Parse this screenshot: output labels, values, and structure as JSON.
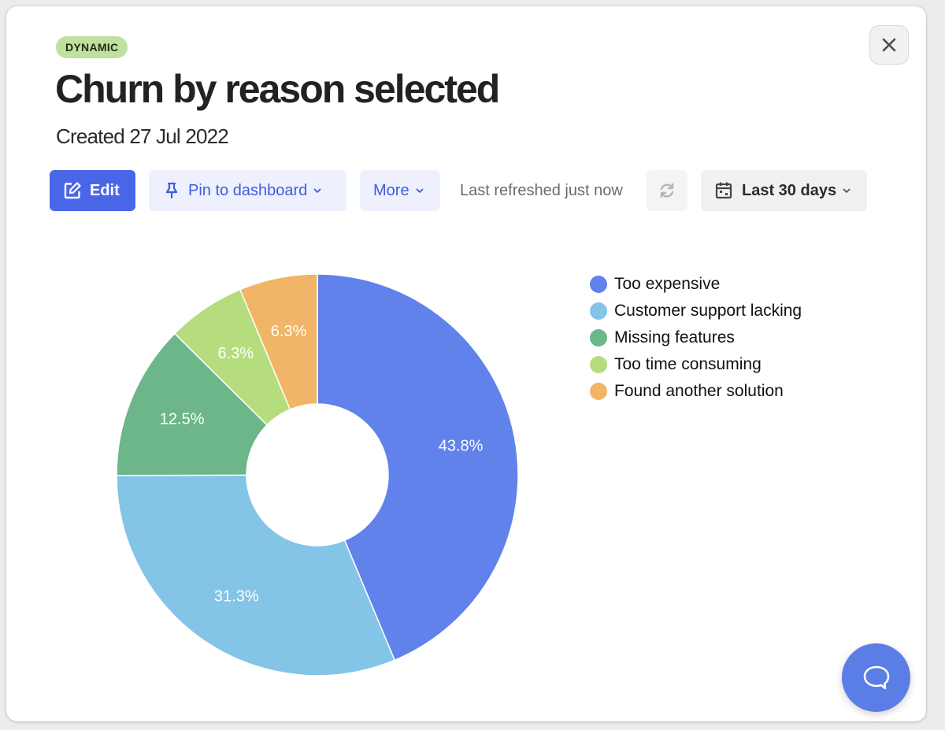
{
  "header": {
    "badge": "DYNAMIC",
    "title": "Churn by reason selected",
    "subtitle": "Created 27 Jul 2022"
  },
  "toolbar": {
    "edit_label": "Edit",
    "pin_label": "Pin to dashboard",
    "more_label": "More",
    "refreshed_text": "Last refreshed just now",
    "date_range_label": "Last 30 days"
  },
  "icons": {
    "close": "close-icon",
    "edit": "edit-icon",
    "pin": "pin-icon",
    "chevron": "chevron-down-icon",
    "refresh": "refresh-icon",
    "calendar": "calendar-icon",
    "chat": "chat-bubble-icon"
  },
  "colors": {
    "accent": "#4a66e8",
    "badge_bg": "#bfe0a0",
    "chat": "#5a7ee6"
  },
  "chart_data": {
    "type": "pie",
    "variant": "donut",
    "title": "",
    "start_angle": "top",
    "direction": "clockwise",
    "legend_position": "right",
    "series": [
      {
        "name": "Too expensive",
        "value": 43.8,
        "label": "43.8%",
        "color": "#6082ea"
      },
      {
        "name": "Customer support lacking",
        "value": 31.3,
        "label": "31.3%",
        "color": "#84c4e6"
      },
      {
        "name": "Missing features",
        "value": 12.5,
        "label": "12.5%",
        "color": "#6cb68a"
      },
      {
        "name": "Too time consuming",
        "value": 6.3,
        "label": "6.3%",
        "color": "#b5dd7e"
      },
      {
        "name": "Found another solution",
        "value": 6.3,
        "label": "6.3%",
        "color": "#f0b566"
      }
    ]
  }
}
